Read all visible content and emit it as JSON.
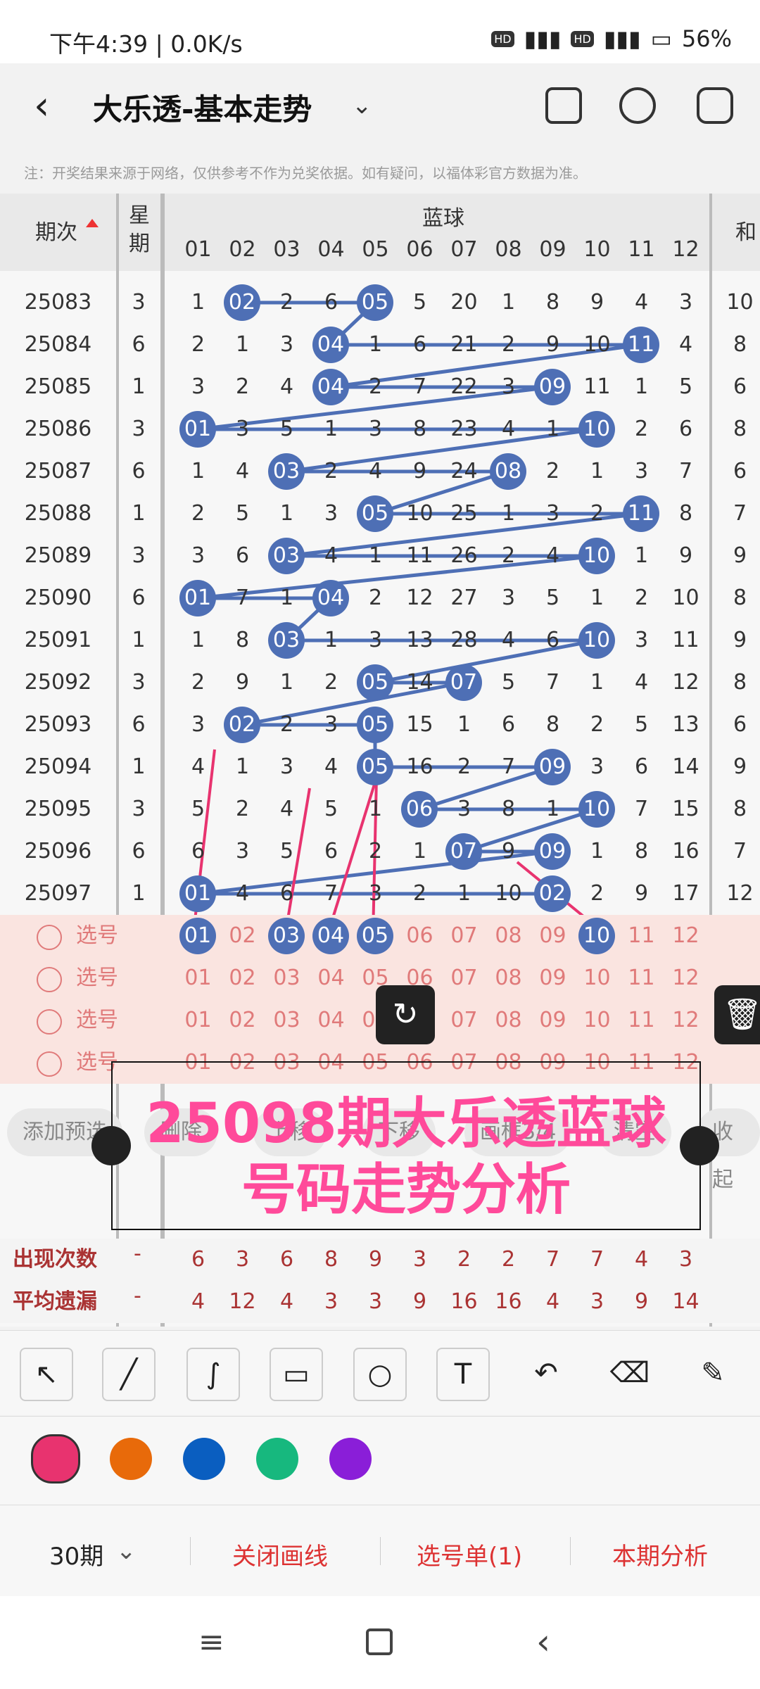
{
  "status": {
    "time": "下午4:39 | 0.0K/s",
    "battery": "56%"
  },
  "header": {
    "title": "大乐透-基本走势"
  },
  "note": "注：开奖结果来源于网络，仅供参考不作为兑奖依据。如有疑问，以福体彩官方数据为准。",
  "table": {
    "col_issue": "期次",
    "col_week": "星期",
    "col_blue": "蓝球",
    "col_sum": "和",
    "numbers": [
      "01",
      "02",
      "03",
      "04",
      "05",
      "06",
      "07",
      "08",
      "09",
      "10",
      "11",
      "12"
    ],
    "rows": [
      {
        "issue": "25083",
        "week": "3",
        "cells": [
          "1",
          "02",
          "2",
          "6",
          "05",
          "5",
          "20",
          "1",
          "8",
          "9",
          "4",
          "3"
        ],
        "balls": [
          1,
          4
        ],
        "sum": "10"
      },
      {
        "issue": "25084",
        "week": "6",
        "cells": [
          "2",
          "1",
          "3",
          "04",
          "1",
          "6",
          "21",
          "2",
          "9",
          "10",
          "11",
          "4"
        ],
        "balls": [
          3,
          10
        ],
        "sum": "8"
      },
      {
        "issue": "25085",
        "week": "1",
        "cells": [
          "3",
          "2",
          "4",
          "04",
          "2",
          "7",
          "22",
          "3",
          "09",
          "11",
          "1",
          "5"
        ],
        "balls": [
          3,
          8
        ],
        "sum": "6"
      },
      {
        "issue": "25086",
        "week": "3",
        "cells": [
          "01",
          "3",
          "5",
          "1",
          "3",
          "8",
          "23",
          "4",
          "1",
          "10",
          "2",
          "6"
        ],
        "balls": [
          0,
          9
        ],
        "sum": "8"
      },
      {
        "issue": "25087",
        "week": "6",
        "cells": [
          "1",
          "4",
          "03",
          "2",
          "4",
          "9",
          "24",
          "08",
          "2",
          "1",
          "3",
          "7"
        ],
        "balls": [
          2,
          7
        ],
        "sum": "6"
      },
      {
        "issue": "25088",
        "week": "1",
        "cells": [
          "2",
          "5",
          "1",
          "3",
          "05",
          "10",
          "25",
          "1",
          "3",
          "2",
          "11",
          "8"
        ],
        "balls": [
          4,
          10
        ],
        "sum": "7"
      },
      {
        "issue": "25089",
        "week": "3",
        "cells": [
          "3",
          "6",
          "03",
          "4",
          "1",
          "11",
          "26",
          "2",
          "4",
          "10",
          "1",
          "9"
        ],
        "balls": [
          2,
          9
        ],
        "sum": "9"
      },
      {
        "issue": "25090",
        "week": "6",
        "cells": [
          "01",
          "7",
          "1",
          "04",
          "2",
          "12",
          "27",
          "3",
          "5",
          "1",
          "2",
          "10"
        ],
        "balls": [
          0,
          3
        ],
        "sum": "8"
      },
      {
        "issue": "25091",
        "week": "1",
        "cells": [
          "1",
          "8",
          "03",
          "1",
          "3",
          "13",
          "28",
          "4",
          "6",
          "10",
          "3",
          "11"
        ],
        "balls": [
          2,
          9
        ],
        "sum": "9"
      },
      {
        "issue": "25092",
        "week": "3",
        "cells": [
          "2",
          "9",
          "1",
          "2",
          "05",
          "14",
          "07",
          "5",
          "7",
          "1",
          "4",
          "12"
        ],
        "balls": [
          4,
          6
        ],
        "sum": "8"
      },
      {
        "issue": "25093",
        "week": "6",
        "cells": [
          "3",
          "02",
          "2",
          "3",
          "05",
          "15",
          "1",
          "6",
          "8",
          "2",
          "5",
          "13"
        ],
        "balls": [
          1,
          4
        ],
        "sum": "6"
      },
      {
        "issue": "25094",
        "week": "1",
        "cells": [
          "4",
          "1",
          "3",
          "4",
          "05",
          "16",
          "2",
          "7",
          "09",
          "3",
          "6",
          "14"
        ],
        "balls": [
          4,
          8
        ],
        "sum": "9"
      },
      {
        "issue": "25095",
        "week": "3",
        "cells": [
          "5",
          "2",
          "4",
          "5",
          "1",
          "06",
          "3",
          "8",
          "1",
          "10",
          "7",
          "15"
        ],
        "balls": [
          5,
          9
        ],
        "sum": "8"
      },
      {
        "issue": "25096",
        "week": "6",
        "cells": [
          "6",
          "3",
          "5",
          "6",
          "2",
          "1",
          "07",
          "9",
          "09",
          "1",
          "8",
          "16"
        ],
        "balls": [
          6,
          8
        ],
        "sum": "7"
      },
      {
        "issue": "25097",
        "week": "1",
        "cells": [
          "01",
          "4",
          "6",
          "7",
          "3",
          "2",
          "1",
          "10",
          "02",
          "2",
          "9",
          "17"
        ],
        "balls": [
          0,
          8
        ],
        "sum": "12"
      }
    ],
    "pick_label": "选号",
    "pick_row_balls": [
      0,
      2,
      3,
      4,
      9
    ]
  },
  "actions": [
    "添加预选",
    "删除",
    "上移",
    "下移",
    "画框3/4",
    "清空",
    "收起"
  ],
  "overlay": {
    "line1": "25098期大乐透蓝球",
    "line2": "号码走势分析"
  },
  "stats": {
    "appear_label": "出现次数",
    "appear": [
      "6",
      "3",
      "6",
      "8",
      "9",
      "3",
      "2",
      "2",
      "7",
      "7",
      "4",
      "3"
    ],
    "miss_label": "平均遗漏",
    "miss": [
      "4",
      "12",
      "4",
      "3",
      "3",
      "9",
      "16",
      "16",
      "4",
      "3",
      "9",
      "14"
    ],
    "dash": "-"
  },
  "colors": [
    "#e8336f",
    "#e86a0a",
    "#0a5ec0",
    "#17b87e",
    "#8a1ed8"
  ],
  "bottom": {
    "period": "30期",
    "close_line": "关闭画线",
    "pick_list": "选号单(1)",
    "analysis": "本期分析"
  }
}
